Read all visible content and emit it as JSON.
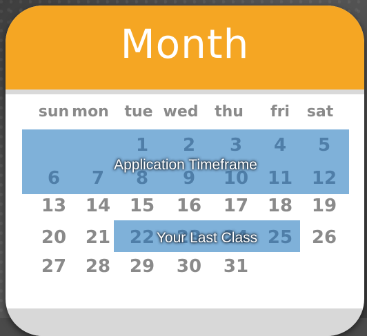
{
  "title": "Month",
  "weekdays": [
    "sun",
    "mon",
    "tue",
    "wed",
    "thu",
    "fri",
    "sat"
  ],
  "weeks": [
    [
      "",
      "",
      "1",
      "2",
      "3",
      "4",
      "5"
    ],
    [
      "6",
      "7",
      "8",
      "9",
      "10",
      "11",
      "12"
    ],
    [
      "13",
      "14",
      "15",
      "16",
      "17",
      "18",
      "19"
    ],
    [
      "20",
      "21",
      "22",
      "23",
      "24",
      "25",
      "26"
    ],
    [
      "27",
      "28",
      "29",
      "30",
      "31",
      "",
      ""
    ]
  ],
  "highlights": {
    "application": "Application Timeframe",
    "last_class": "Your Last Class"
  },
  "colors": {
    "header": "#f5a623",
    "highlight": "#74aad6",
    "day_text": "#8a8a8a",
    "highlighted_day_text": "#4f7ea8"
  }
}
